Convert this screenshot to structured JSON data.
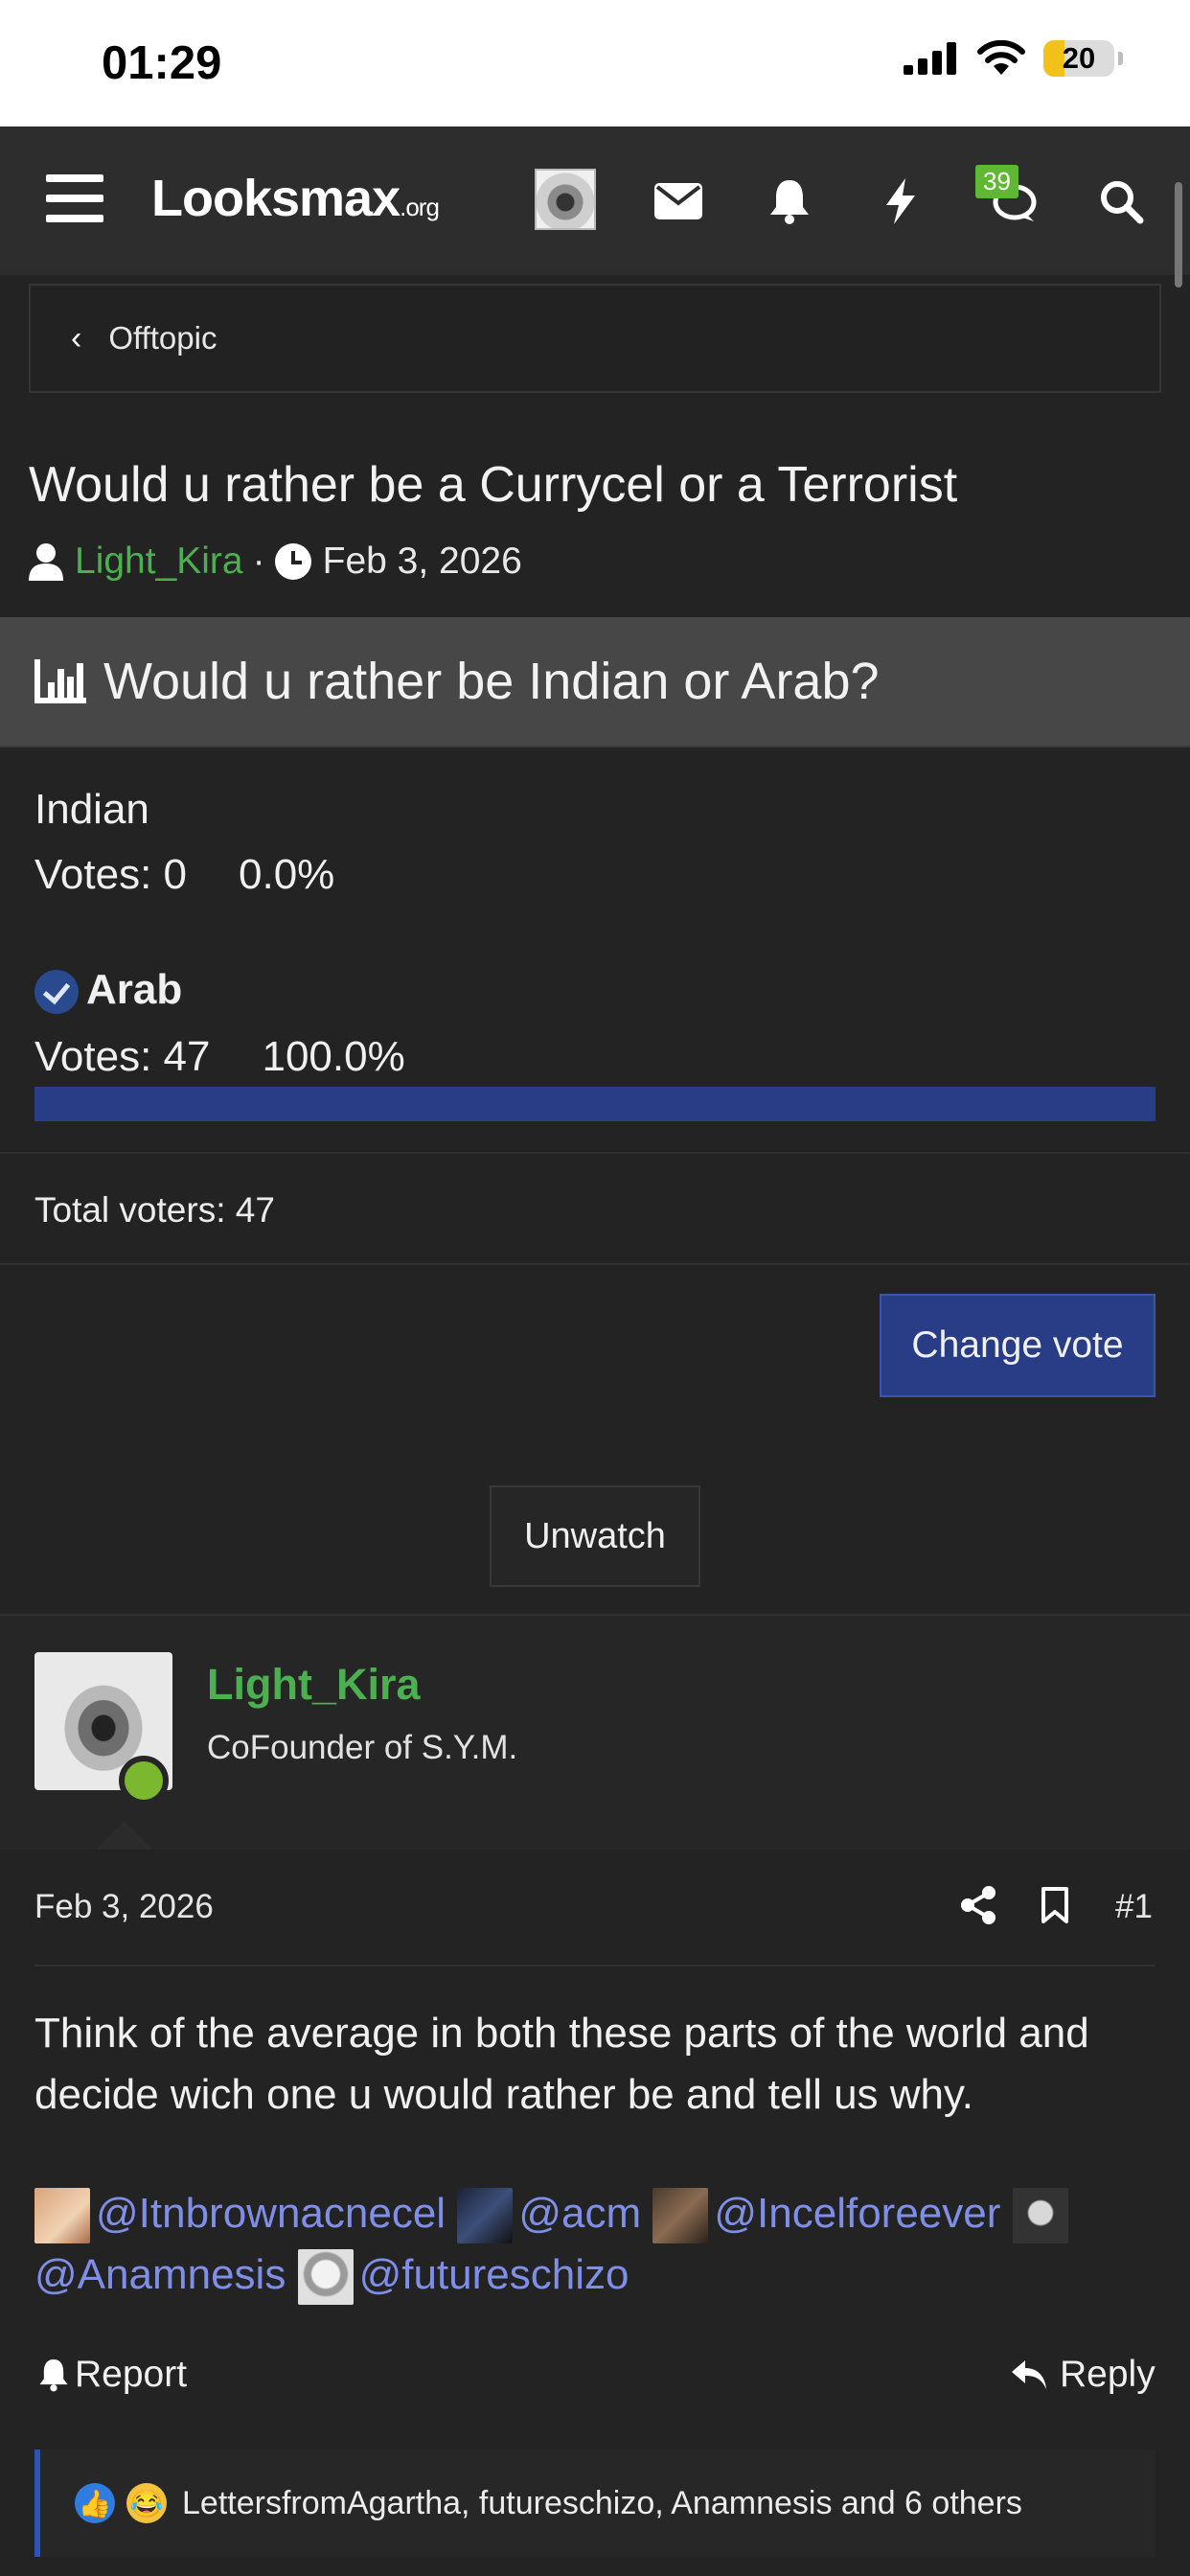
{
  "status_bar": {
    "time": "01:29",
    "battery": "20"
  },
  "nav": {
    "logo_main": "Looksmax",
    "logo_suffix": ".org",
    "chat_badge": "39"
  },
  "breadcrumb": {
    "label": "Offtopic"
  },
  "thread": {
    "title": "Would u rather be a Currycel or a Terrorist",
    "author": "Light_Kira",
    "date": "Feb 3, 2026"
  },
  "poll": {
    "question": "Would u rather be Indian or Arab?",
    "options": [
      {
        "label": "Indian",
        "votes": "Votes: 0",
        "percent": "0.0%",
        "fraction": 0.0
      },
      {
        "label": "Arab",
        "votes": "Votes: 47",
        "percent": "100.0%",
        "fraction": 1.0,
        "selected": true
      }
    ],
    "total": "Total voters: 47",
    "change_vote_label": "Change vote",
    "accent_color": "#283d85"
  },
  "unwatch_label": "Unwatch",
  "post": {
    "username": "Light_Kira",
    "user_title": "CoFounder of S.Y.M.",
    "date": "Feb 3, 2026",
    "number": "#1",
    "body": "Think of the average in both these parts of the world and decide wich one u would rather be and tell us why.",
    "mentions": [
      "@Itnbrownacnecel",
      "@acm",
      "@Incelforeever",
      "@Anamnesis",
      "@futureschizo"
    ],
    "report_label": "Report",
    "reply_label": "Reply",
    "reactions_text": "LettersfromAgartha, futureschizo, Anamnesis and 6 others"
  },
  "colors": {
    "username": "#4caf50",
    "mention": "#7f8fe8",
    "online": "#7cb82f"
  }
}
